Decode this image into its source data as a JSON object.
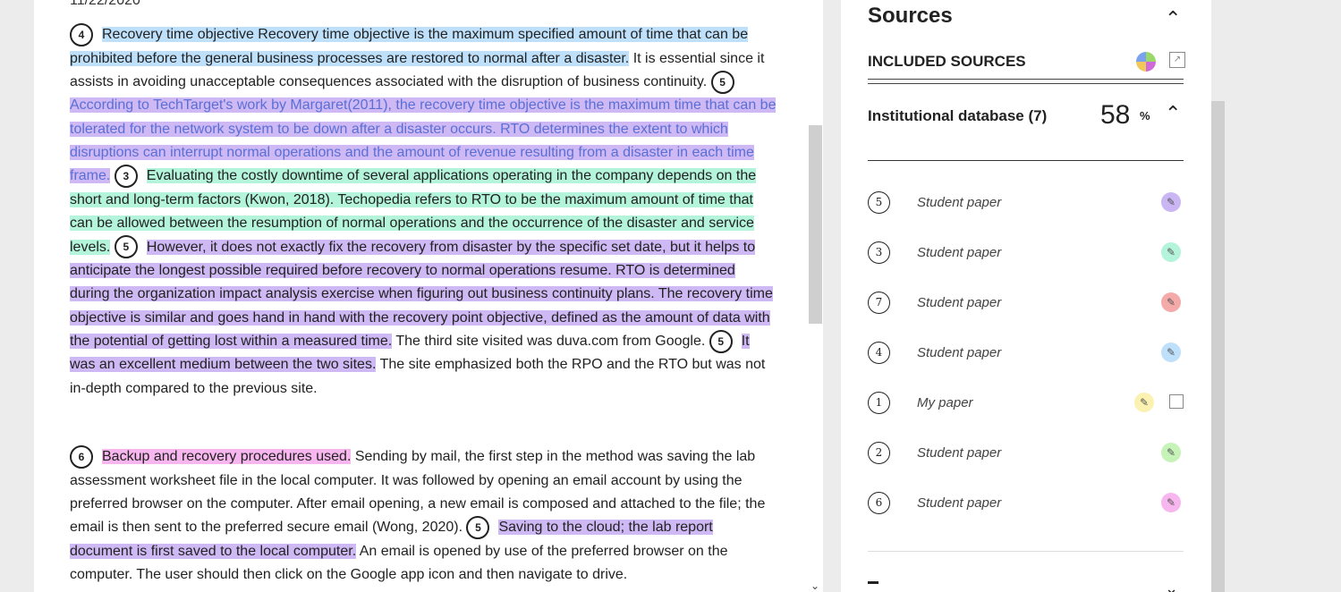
{
  "document": {
    "date": "11/22/2020",
    "p1": {
      "num1": "4",
      "s1": "Recovery time objective Recovery time objective is the maximum specified amount of time that can be prohibited before the general business processes are restored to normal after a disaster.",
      "s2": " It is essential since it assists in avoiding unacceptable consequences associated with the disruption of business continuity. ",
      "num2": "5",
      "s3": "According to TechTarget's work by Margaret(2011), the recovery time objective is the maximum time that can be tolerated for the network system to be down after a disaster occurs. RTO determines the extent to which disruptions can interrupt normal operations and the amount of revenue resulting from a disaster in each time frame.",
      "num3": "3",
      "s4": "Evaluating the costly downtime of several applications operating in the company depends on the short and long-term factors (Kwon, 2018). Techopedia refers to RTO to be the maximum amount of time that can be allowed between the resumption of normal operations and the occurrence of the disaster and service levels.",
      "num4": "5",
      "s5": "However, it does not exactly fix the recovery from disaster by the specific set date, but it helps to anticipate the longest possible required before recovery to normal operations resume. RTO is determined during the organization impact analysis exercise when figuring out business continuity plans. The recovery time objective is similar and goes hand in hand with the recovery point objective, defined as the amount of data with the potential of getting lost within a measured time.",
      "s6": " The third site visited was duva.com from Google. ",
      "num5": "5",
      "s7": "It was an excellent medium between the two sites.",
      "s8": " The site emphasized both the RPO and the RTO but was not in-depth compared to the previous site."
    },
    "p2": {
      "num1": "6",
      "s1": "Backup and recovery procedures used.",
      "s2": " Sending by mail, the first step in the method was saving the lab assessment worksheet file in the local computer. It was followed by opening an email account by using the preferred browser on the computer. After email opening, a new email is composed and attached to the file; the email is then sent to the preferred secure email (Wong, 2020). ",
      "num2": "5",
      "s3": "Saving to the cloud; the lab report document is first saved to the local computer.",
      "s4": " An email is opened by use of the preferred browser on the computer. The user should then click on the Google app icon and then navigate to drive."
    }
  },
  "sources": {
    "title": "Sources",
    "included_label": "INCLUDED SOURCES",
    "db_title": "Institutional database (7)",
    "db_percent": "58",
    "db_percent_symbol": "%",
    "items": [
      {
        "num": "5",
        "label": "Student paper",
        "color": "#c9b6f2"
      },
      {
        "num": "3",
        "label": "Student paper",
        "color": "#b3f4da"
      },
      {
        "num": "7",
        "label": "Student paper",
        "color": "#f5aaaa"
      },
      {
        "num": "4",
        "label": "Student paper",
        "color": "#bfe0fb"
      },
      {
        "num": "1",
        "label": "My paper",
        "color": "#fbf1b0"
      },
      {
        "num": "2",
        "label": "Student paper",
        "color": "#c6f3b8"
      },
      {
        "num": "6",
        "label": "Student paper",
        "color": "#f7b6ee"
      }
    ]
  }
}
